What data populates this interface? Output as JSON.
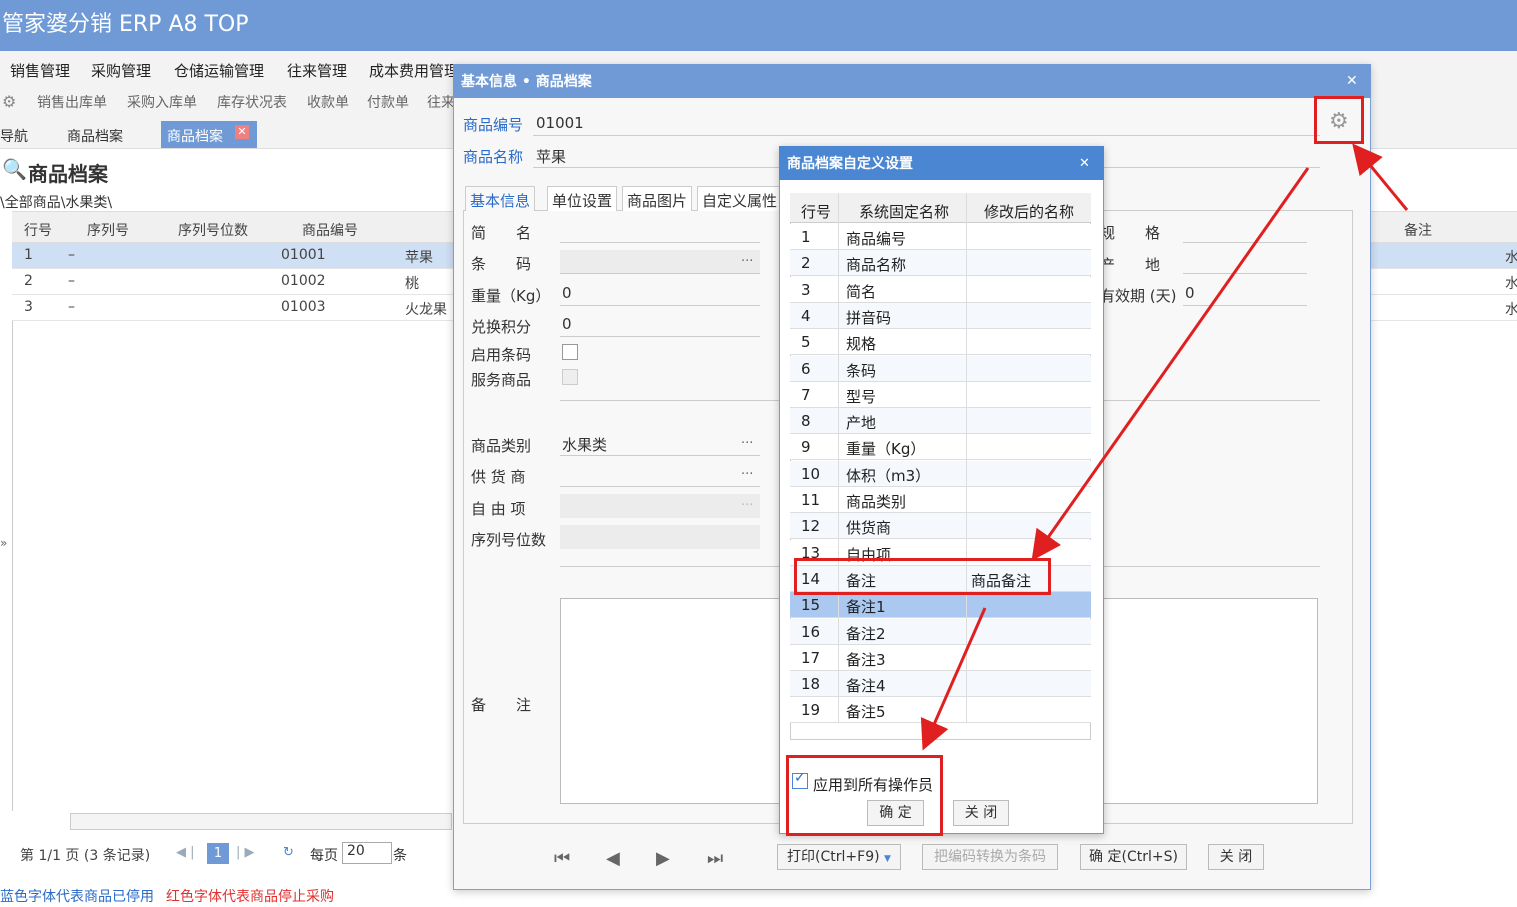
{
  "app": {
    "title": "管家婆分销 ERP A8 TOP"
  },
  "menu": [
    "销售管理",
    "采购管理",
    "仓储运输管理",
    "往来管理",
    "成本费用管理"
  ],
  "toolbar": [
    "销售出库单",
    "采购入库单",
    "库存状况表",
    "收款单",
    "付款单",
    "往来"
  ],
  "tabs": {
    "nav": "导航",
    "tab1": "商品档案",
    "tab2": "商品档案"
  },
  "page": {
    "title": "商品档案",
    "breadcrumb": "\\全部商品\\水果类\\"
  },
  "grid": {
    "headers": [
      "行号",
      "序列号",
      "序列号位数",
      "商品编号"
    ],
    "right_header": "备注",
    "rows": [
      {
        "no": "1",
        "serial": "–",
        "code": "01001",
        "name": "苹果",
        "remark": "水"
      },
      {
        "no": "2",
        "serial": "–",
        "code": "01002",
        "name": "桃",
        "remark": "水"
      },
      {
        "no": "3",
        "serial": "–",
        "code": "01003",
        "name": "火龙果",
        "remark": "水"
      }
    ]
  },
  "pager": {
    "info": "第 1/1 页 (3 条记录)",
    "page": "1",
    "per_page_label": "每页",
    "per_page": "20",
    "unit": "条"
  },
  "legend": {
    "blue": "蓝色字体代表商品已停用",
    "red": "红色字体代表商品停止采购"
  },
  "dialog": {
    "title": "基本信息 • 商品档案",
    "code_label": "商品编号",
    "code_value": "01001",
    "name_label": "商品名称",
    "name_value": "苹果",
    "subtabs": [
      "基本信息",
      "单位设置",
      "商品图片",
      "自定义属性"
    ],
    "fields": {
      "short": "简　　名",
      "barcode": "条　　码",
      "weight": "重量（Kg）",
      "weight_val": "0",
      "points": "兑换积分",
      "points_val": "0",
      "enable_barcode": "启用条码",
      "service": "服务商品",
      "category": "商品类别",
      "category_val": "水果类",
      "supplier": "供 货 商",
      "free": "自 由 项",
      "serial_digits": "序列号位数",
      "remark": "备　　注",
      "spec": "规　　格",
      "origin": "产　　地",
      "validity": "有效期 (天)",
      "validity_val": "0"
    },
    "buttons": {
      "print": "打印(Ctrl+F9)",
      "convert": "把编码转换为条码",
      "ok": "确 定(Ctrl+S)",
      "close": "关 闭"
    }
  },
  "custom_dialog": {
    "title": "商品档案自定义设置",
    "headers": [
      "行号",
      "系统固定名称",
      "修改后的名称"
    ],
    "rows": [
      {
        "no": "1",
        "name": "商品编号",
        "new": ""
      },
      {
        "no": "2",
        "name": "商品名称",
        "new": ""
      },
      {
        "no": "3",
        "name": "简名",
        "new": ""
      },
      {
        "no": "4",
        "name": "拼音码",
        "new": ""
      },
      {
        "no": "5",
        "name": "规格",
        "new": ""
      },
      {
        "no": "6",
        "name": "条码",
        "new": ""
      },
      {
        "no": "7",
        "name": "型号",
        "new": ""
      },
      {
        "no": "8",
        "name": "产地",
        "new": ""
      },
      {
        "no": "9",
        "name": "重量（Kg）",
        "new": ""
      },
      {
        "no": "10",
        "name": "体积（m3）",
        "new": ""
      },
      {
        "no": "11",
        "name": "商品类别",
        "new": ""
      },
      {
        "no": "12",
        "name": "供货商",
        "new": ""
      },
      {
        "no": "13",
        "name": "自由项",
        "new": ""
      },
      {
        "no": "14",
        "name": "备注",
        "new": "商品备注"
      },
      {
        "no": "15",
        "name": "备注1",
        "new": ""
      },
      {
        "no": "16",
        "name": "备注2",
        "new": ""
      },
      {
        "no": "17",
        "name": "备注3",
        "new": ""
      },
      {
        "no": "18",
        "name": "备注4",
        "new": ""
      },
      {
        "no": "19",
        "name": "备注5",
        "new": ""
      }
    ],
    "apply_all": "应用到所有操作员",
    "ok": "确 定",
    "close": "关 闭"
  }
}
